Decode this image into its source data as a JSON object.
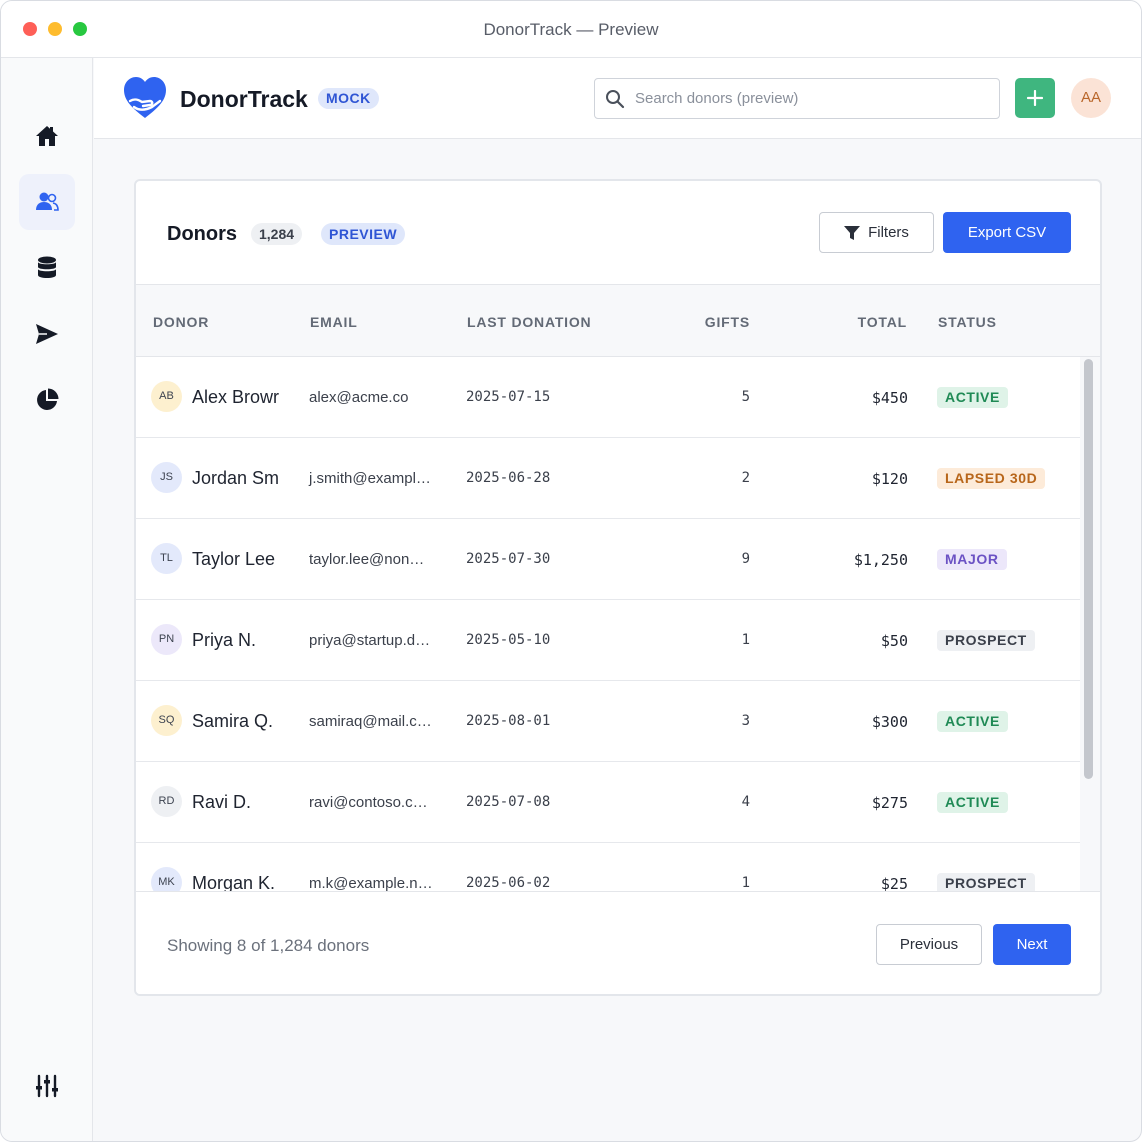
{
  "window": {
    "title": "DonorTrack — Preview"
  },
  "app": {
    "brand": "DonorTrack",
    "badge": "MOCK"
  },
  "sidebar": {
    "items": [
      {
        "name": "home",
        "icon": "home-icon",
        "active": false
      },
      {
        "name": "donors",
        "icon": "users-icon",
        "active": true
      },
      {
        "name": "database",
        "icon": "database-icon",
        "active": false
      },
      {
        "name": "send",
        "icon": "send-icon",
        "active": false
      },
      {
        "name": "reports",
        "icon": "pie-chart-icon",
        "active": false
      }
    ],
    "footer_icon": "sliders-icon"
  },
  "search": {
    "placeholder": "Search donors (preview)",
    "value": ""
  },
  "user": {
    "initials": "AA"
  },
  "card": {
    "title": "Donors",
    "count": "1,284",
    "badge": "PREVIEW",
    "filters_label": "Filters",
    "export_label": "Export CSV"
  },
  "table": {
    "columns": [
      "DONOR",
      "EMAIL",
      "LAST DONATION",
      "GIFTS",
      "TOTAL",
      "STATUS"
    ],
    "rows": [
      {
        "initials": "AB",
        "name": "Alex Browr",
        "email": "alex@acme.co",
        "last_donation": "2025-07-15",
        "gifts": "5",
        "total": "$450",
        "status": "ACTIVE"
      },
      {
        "initials": "JS",
        "name": "Jordan Sm",
        "email": "j.smith@exampl…",
        "last_donation": "2025-06-28",
        "gifts": "2",
        "total": "$120",
        "status": "LAPSED 30D"
      },
      {
        "initials": "TL",
        "name": "Taylor Lee",
        "email": "taylor.lee@non…",
        "last_donation": "2025-07-30",
        "gifts": "9",
        "total": "$1,250",
        "status": "MAJOR"
      },
      {
        "initials": "PN",
        "name": "Priya N.",
        "email": "priya@startup.d…",
        "last_donation": "2025-05-10",
        "gifts": "1",
        "total": "$50",
        "status": "PROSPECT"
      },
      {
        "initials": "SQ",
        "name": "Samira Q.",
        "email": "samiraq@mail.c…",
        "last_donation": "2025-08-01",
        "gifts": "3",
        "total": "$300",
        "status": "ACTIVE"
      },
      {
        "initials": "RD",
        "name": "Ravi D.",
        "email": "ravi@contoso.c…",
        "last_donation": "2025-07-08",
        "gifts": "4",
        "total": "$275",
        "status": "ACTIVE"
      },
      {
        "initials": "MK",
        "name": "Morgan K.",
        "email": "m.k@example.n…",
        "last_donation": "2025-06-02",
        "gifts": "1",
        "total": "$25",
        "status": "PROSPECT"
      }
    ]
  },
  "footer": {
    "showing": "Showing 8 of 1,284 donors",
    "prev_label": "Previous",
    "next_label": "Next"
  },
  "colors": {
    "primary": "#2f63f0",
    "add_button": "#3fb67f",
    "active_bg": "#dff3e8",
    "active_fg": "#1f8a55",
    "lapsed_bg": "#fdebd9",
    "lapsed_fg": "#b8661a",
    "major_bg": "#ece7fa",
    "major_fg": "#6b52c4",
    "prospect_bg": "#eef0f3",
    "prospect_fg": "#3b404b"
  }
}
